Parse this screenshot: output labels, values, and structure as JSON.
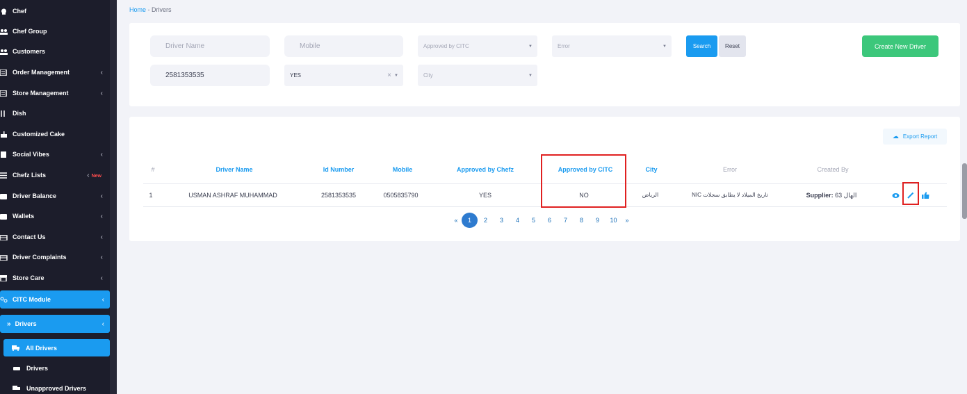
{
  "sidebar": {
    "items": [
      {
        "label": "Chef",
        "chevron": ""
      },
      {
        "label": "Chef Group",
        "chevron": ""
      },
      {
        "label": "Customers",
        "chevron": ""
      },
      {
        "label": "Order Management",
        "chevron": "‹"
      },
      {
        "label": "Store Management",
        "chevron": "‹"
      },
      {
        "label": "Dish",
        "chevron": ""
      },
      {
        "label": "Customized Cake",
        "chevron": ""
      },
      {
        "label": "Social Vibes",
        "chevron": "‹"
      },
      {
        "label": "Chefz Lists",
        "chevron": ""
      },
      {
        "label": "Driver Balance",
        "chevron": "‹"
      },
      {
        "label": "Wallets",
        "chevron": "‹"
      },
      {
        "label": "Contact Us",
        "chevron": "‹"
      },
      {
        "label": "Driver Complaints",
        "chevron": "‹"
      },
      {
        "label": "Store Care",
        "chevron": "‹"
      }
    ],
    "new_badge": "New",
    "citc_module": "CITC Module",
    "drivers_group": "Drivers",
    "sub_items": [
      {
        "label": "All Drivers"
      },
      {
        "label": "Drivers"
      },
      {
        "label": "Unapproved Drivers"
      }
    ]
  },
  "breadcrumb": {
    "home": "Home",
    "separator": "-",
    "current": "Drivers"
  },
  "filters": {
    "driver_name_placeholder": "Driver Name",
    "mobile_placeholder": "Mobile",
    "approved_by_citc_placeholder": "Approved by CITC",
    "error_placeholder": "Error",
    "id_number_value": "2581353535",
    "approved_by_chefz_value": "YES",
    "city_placeholder": "City",
    "search_label": "Search",
    "reset_label": "Reset",
    "create_label": "Create New Driver"
  },
  "table": {
    "export_label": "Export Report",
    "headers": {
      "index": "#",
      "driver_name": "Driver Name",
      "id_number": "Id Number",
      "mobile": "Mobile",
      "approved_chefz": "Approved by Chefz",
      "approved_citc": "Approved by CITC",
      "city": "City",
      "error": "Error",
      "created_by": "Created By"
    },
    "rows": [
      {
        "index": "1",
        "driver_name": "USMAN ASHRAF MUHAMMAD",
        "id_number": "2581353535",
        "mobile": "0505835790",
        "approved_chefz": "YES",
        "approved_citc": "NO",
        "city": "الرياض",
        "error": "NIC تاريخ الميلاد لا يطابق سجلات",
        "created_by_label": "Supplier:",
        "created_by_value": "الهال 63"
      }
    ]
  },
  "pagination": {
    "prev": "«",
    "next": "»",
    "pages": [
      "1",
      "2",
      "3",
      "4",
      "5",
      "6",
      "7",
      "8",
      "9",
      "10"
    ],
    "current": "1"
  },
  "colors": {
    "accent": "#1a9bf0",
    "create": "#3cc77b",
    "highlight": "#e02020",
    "sidebar": "#1c1d2b"
  }
}
